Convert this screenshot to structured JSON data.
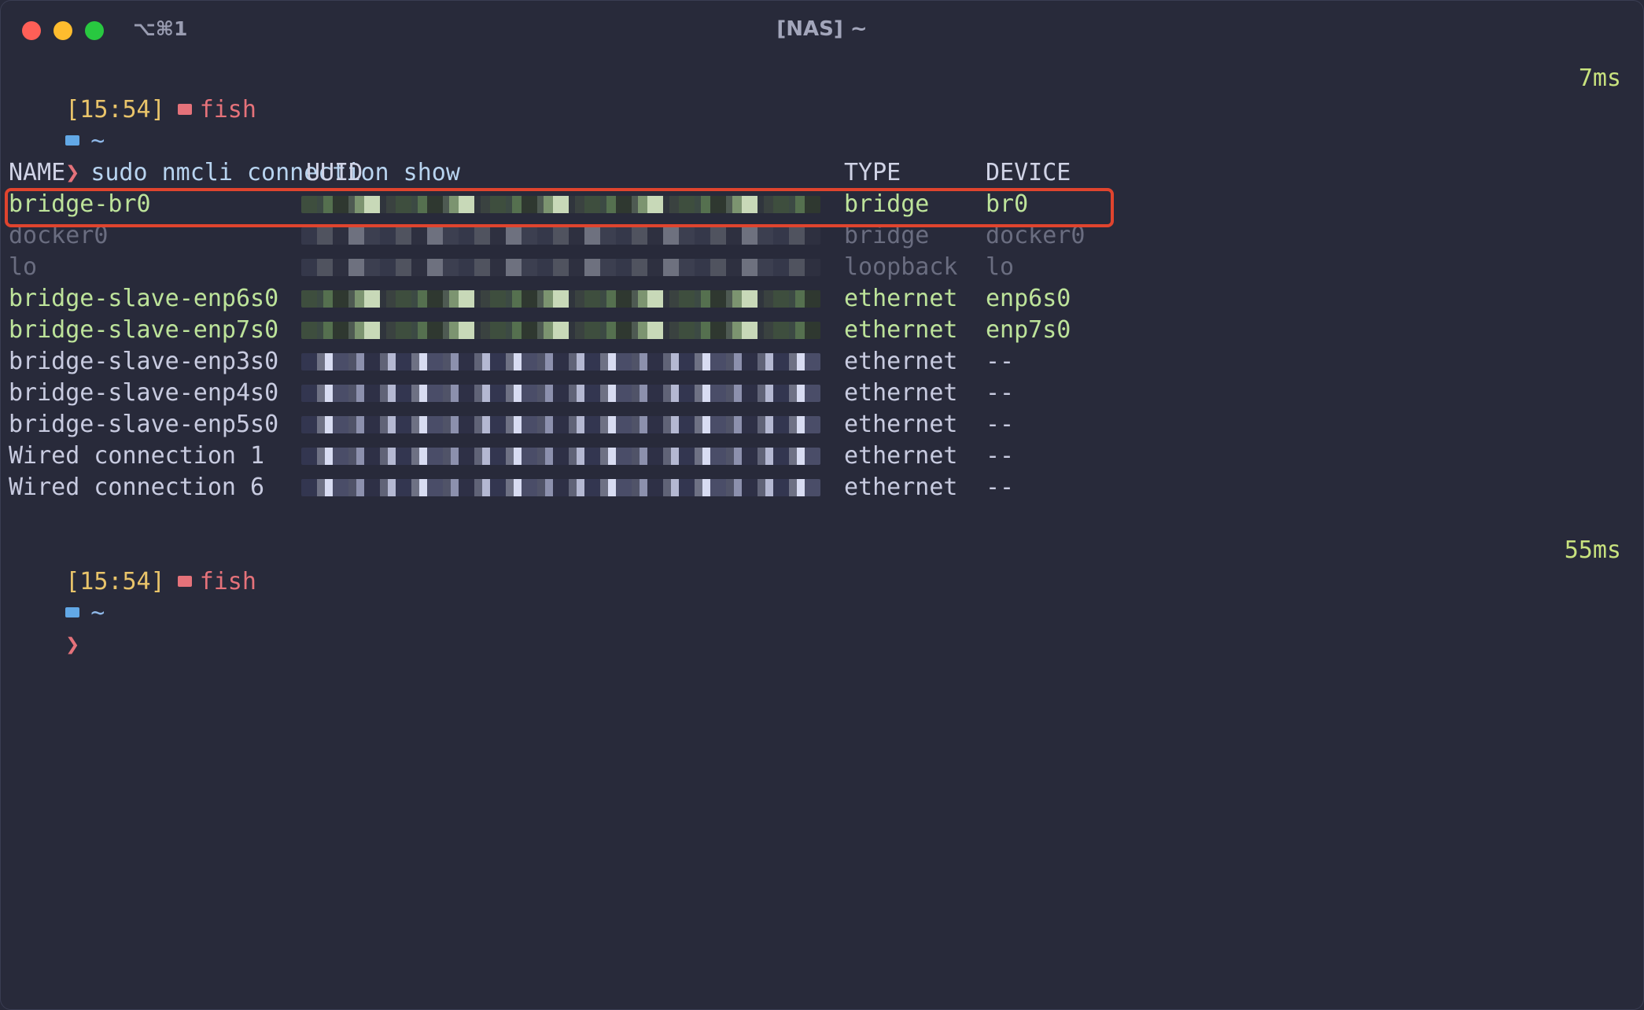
{
  "window": {
    "title": "[NAS] ~",
    "shortcut": "⌥⌘1"
  },
  "prompt1": {
    "time": "[15:54]",
    "shell": "fish",
    "duration": "7ms",
    "dir": "~",
    "symbol": "❯",
    "command": "sudo nmcli connection show"
  },
  "table": {
    "headers": {
      "name": "NAME",
      "uuid": "UUID",
      "type": "TYPE",
      "device": "DEVICE"
    },
    "rows": [
      {
        "name": "bridge-br0",
        "type": "bridge",
        "device": "br0",
        "state": "active"
      },
      {
        "name": "docker0",
        "type": "bridge",
        "device": "docker0",
        "state": "dim"
      },
      {
        "name": "lo",
        "type": "loopback",
        "device": "lo",
        "state": "dim"
      },
      {
        "name": "bridge-slave-enp6s0",
        "type": "ethernet",
        "device": "enp6s0",
        "state": "active"
      },
      {
        "name": "bridge-slave-enp7s0",
        "type": "ethernet",
        "device": "enp7s0",
        "state": "active"
      },
      {
        "name": "bridge-slave-enp3s0",
        "type": "ethernet",
        "device": "--",
        "state": "inactive"
      },
      {
        "name": "bridge-slave-enp4s0",
        "type": "ethernet",
        "device": "--",
        "state": "inactive"
      },
      {
        "name": "bridge-slave-enp5s0",
        "type": "ethernet",
        "device": "--",
        "state": "inactive"
      },
      {
        "name": "Wired connection 1",
        "type": "ethernet",
        "device": "--",
        "state": "inactive"
      },
      {
        "name": "Wired connection 6",
        "type": "ethernet",
        "device": "--",
        "state": "inactive"
      }
    ]
  },
  "prompt2": {
    "time": "[15:54]",
    "shell": "fish",
    "duration": "55ms",
    "dir": "~",
    "symbol": "❯"
  },
  "colors": {
    "highlight": "#e0442e",
    "active": "#bde39a",
    "time": "#e9c46a",
    "accent": "#e5727a",
    "background": "#282a3a"
  }
}
